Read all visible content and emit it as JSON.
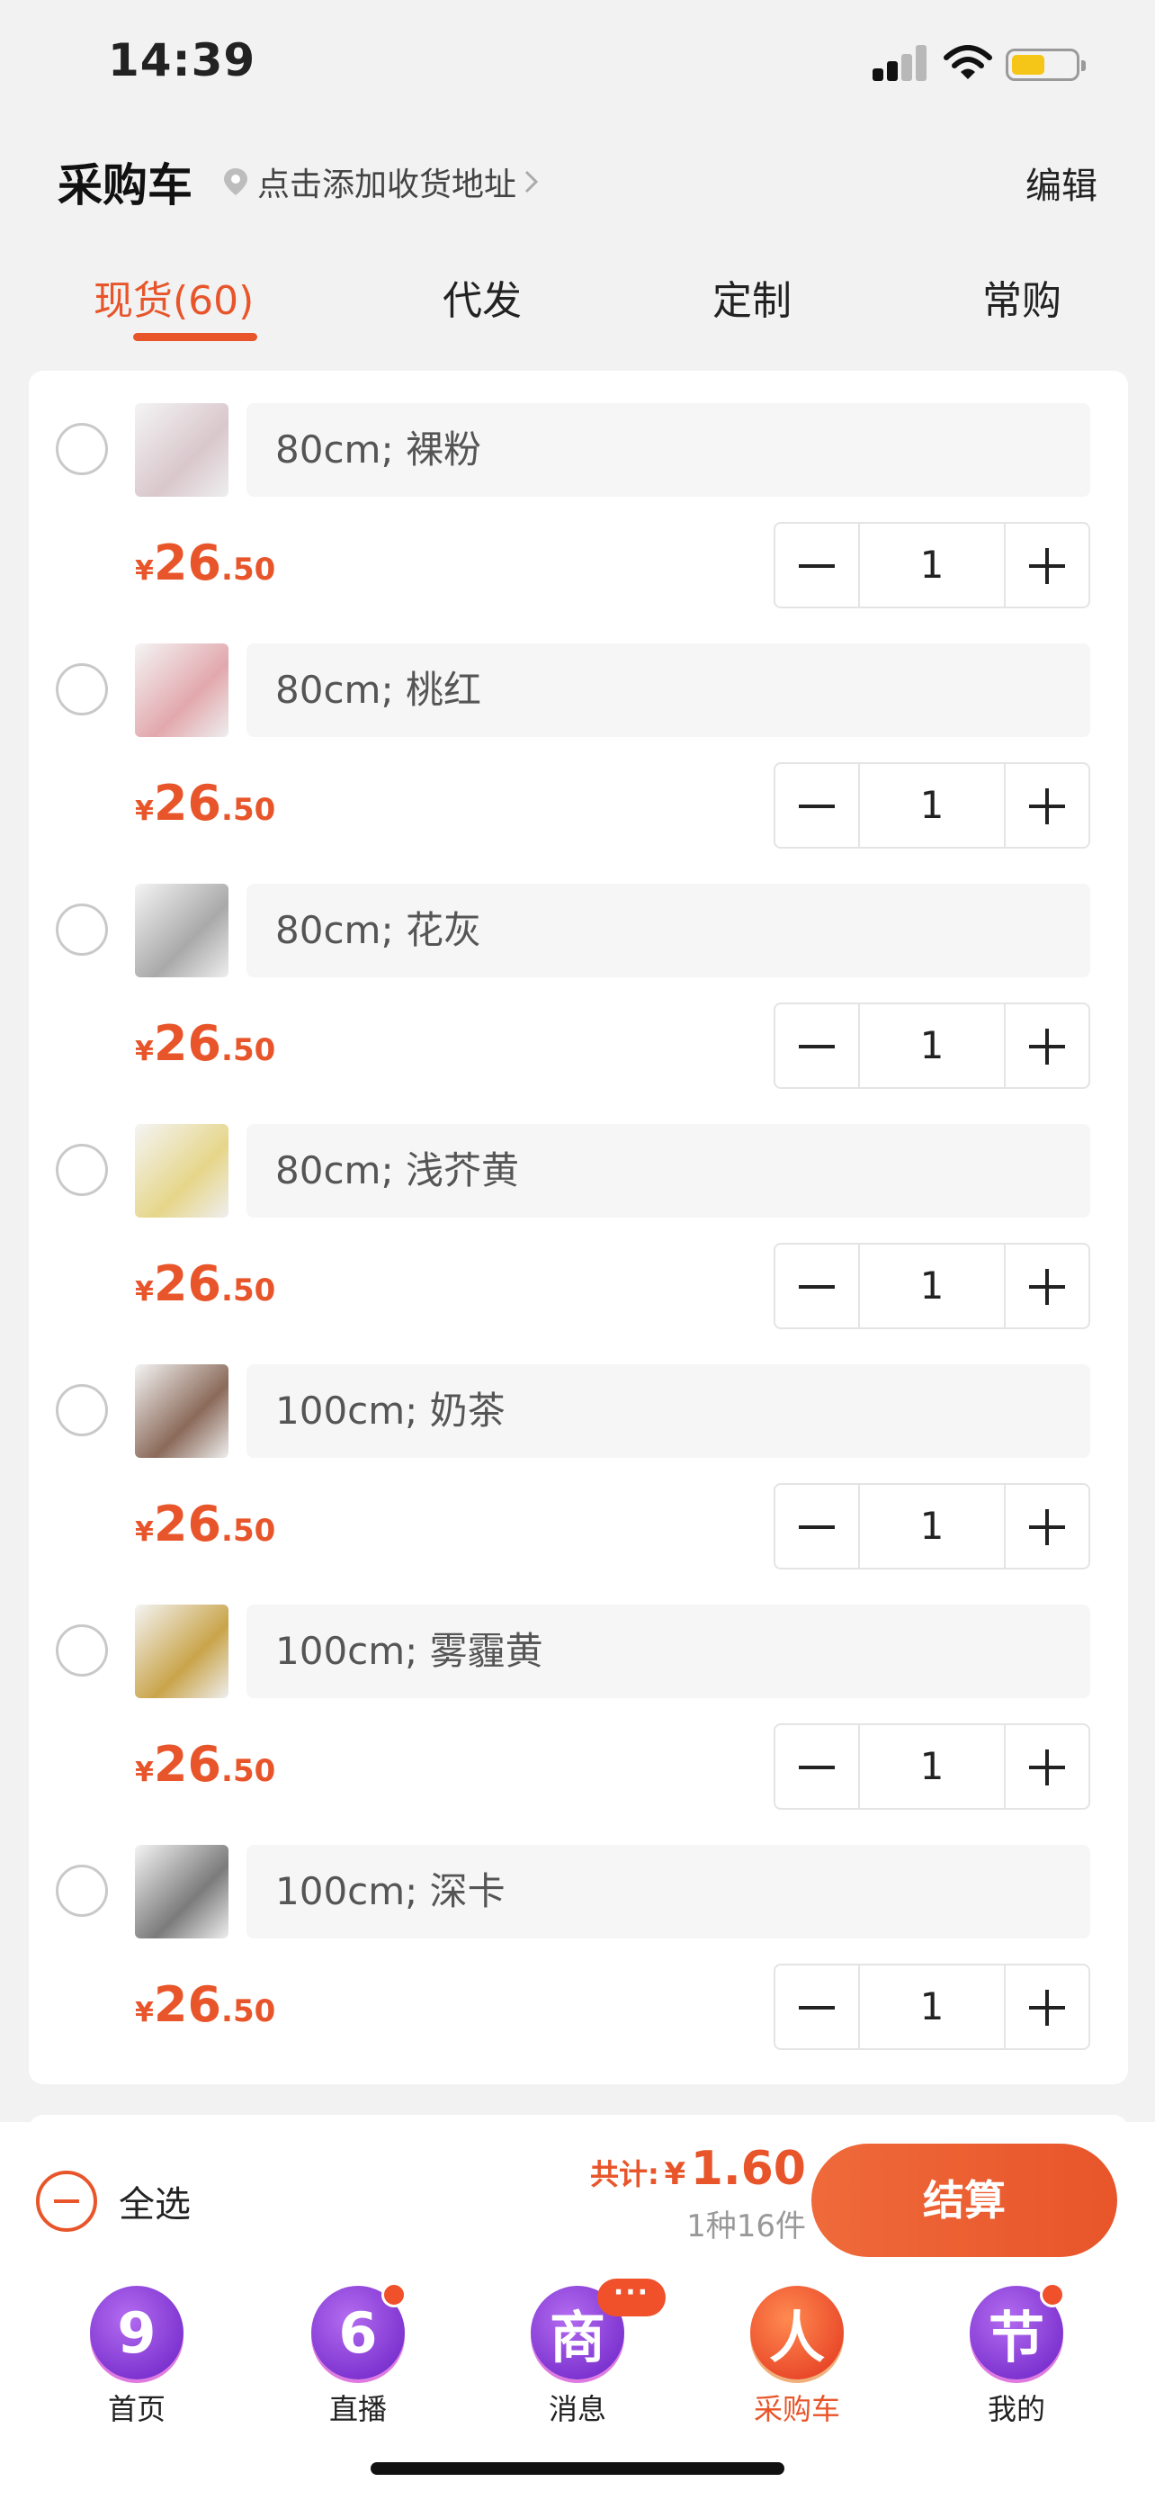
{
  "status_bar": {
    "time": "14:39"
  },
  "header": {
    "title": "采购车",
    "address_prompt": "点击添加收货地址",
    "edit_label": "编辑"
  },
  "tabs": [
    {
      "label": "现货(60)",
      "active": true
    },
    {
      "label": "代发",
      "active": false
    },
    {
      "label": "定制",
      "active": false
    },
    {
      "label": "常购",
      "active": false
    }
  ],
  "items": [
    {
      "spec": "80cm; 裸粉",
      "currency": "¥",
      "price_int": "26",
      "price_dec": ".50",
      "quantity": "1",
      "thumb_color": "#d9c7cc"
    },
    {
      "spec": "80cm; 桃红",
      "currency": "¥",
      "price_int": "26",
      "price_dec": ".50",
      "quantity": "1",
      "thumb_color": "#e2a8ad"
    },
    {
      "spec": "80cm; 花灰",
      "currency": "¥",
      "price_int": "26",
      "price_dec": ".50",
      "quantity": "1",
      "thumb_color": "#a9a9a9"
    },
    {
      "spec": "80cm; 浅芥黄",
      "currency": "¥",
      "price_int": "26",
      "price_dec": ".50",
      "quantity": "1",
      "thumb_color": "#e6d68a"
    },
    {
      "spec": "100cm; 奶茶",
      "currency": "¥",
      "price_int": "26",
      "price_dec": ".50",
      "quantity": "1",
      "thumb_color": "#8b6a5a"
    },
    {
      "spec": "100cm; 雾霾黄",
      "currency": "¥",
      "price_int": "26",
      "price_dec": ".50",
      "quantity": "1",
      "thumb_color": "#c9a44a"
    },
    {
      "spec": "100cm; 深卡",
      "currency": "¥",
      "price_int": "26",
      "price_dec": ".50",
      "quantity": "1",
      "thumb_color": "#7b7b7b"
    }
  ],
  "checkout": {
    "select_all_label": "全选",
    "total_label": "共计:",
    "total_currency": "¥",
    "total_value": "1.60",
    "count_text": "1种16件",
    "button_label": "结算"
  },
  "nav": [
    {
      "glyph": "9",
      "label": "首页",
      "active": false,
      "badge": ""
    },
    {
      "glyph": "6",
      "label": "直播",
      "active": false,
      "badge": "dot"
    },
    {
      "glyph": "商",
      "label": "消息",
      "active": false,
      "badge": "more"
    },
    {
      "glyph": "人",
      "label": "采购车",
      "active": true,
      "badge": ""
    },
    {
      "glyph": "节",
      "label": "我的",
      "active": false,
      "badge": "dot"
    }
  ],
  "colors": {
    "accent": "#e8552a",
    "background": "#f2f2f2"
  }
}
